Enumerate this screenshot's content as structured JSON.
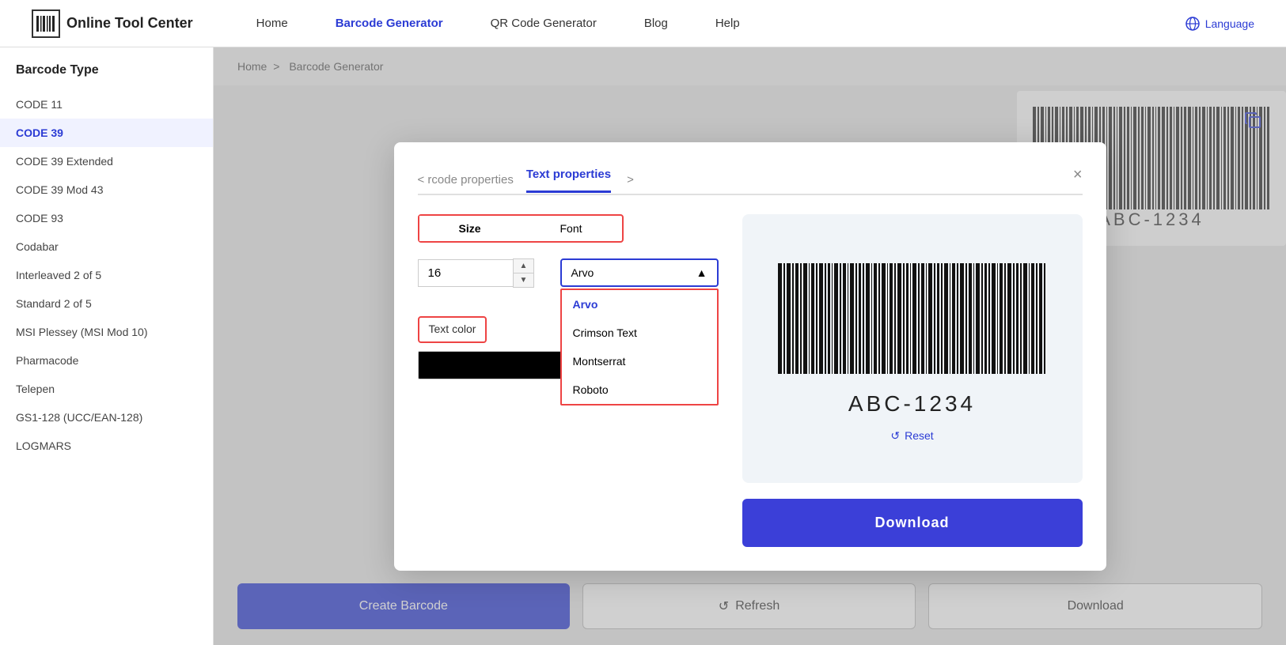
{
  "header": {
    "logo_text": "Online Tool Center",
    "nav_items": [
      {
        "label": "Home",
        "active": false
      },
      {
        "label": "Barcode Generator",
        "active": true
      },
      {
        "label": "QR Code Generator",
        "active": false
      },
      {
        "label": "Blog",
        "active": false
      },
      {
        "label": "Help",
        "active": false
      }
    ],
    "language_label": "Language"
  },
  "breadcrumb": {
    "home": "Home",
    "separator": ">",
    "current": "Barcode Generator"
  },
  "sidebar": {
    "title": "Barcode Type",
    "items": [
      {
        "label": "CODE 11",
        "active": false
      },
      {
        "label": "CODE 39",
        "active": true
      },
      {
        "label": "CODE 39 Extended",
        "active": false
      },
      {
        "label": "CODE 39 Mod 43",
        "active": false
      },
      {
        "label": "CODE 93",
        "active": false
      },
      {
        "label": "Codabar",
        "active": false
      },
      {
        "label": "Interleaved 2 of 5",
        "active": false
      },
      {
        "label": "Standard 2 of 5",
        "active": false
      },
      {
        "label": "MSI Plessey (MSI Mod 10)",
        "active": false
      },
      {
        "label": "Pharmacode",
        "active": false
      },
      {
        "label": "Telepen",
        "active": false
      },
      {
        "label": "GS1-128 (UCC/EAN-128)",
        "active": false
      },
      {
        "label": "LOGMARS",
        "active": false
      }
    ]
  },
  "modal": {
    "tab_prev": "< rcode properties",
    "tab_active": "Text properties",
    "tab_next": ">",
    "close_label": "×",
    "sub_tabs": [
      {
        "label": "Size",
        "active": true
      },
      {
        "label": "Font",
        "active": false
      }
    ],
    "size_value": "16",
    "font_selected": "Arvo",
    "font_options": [
      {
        "label": "Arvo",
        "selected": true
      },
      {
        "label": "Crimson Text",
        "selected": false
      },
      {
        "label": "Montserrat",
        "selected": false
      },
      {
        "label": "Roboto",
        "selected": false
      }
    ],
    "text_color_label": "Text color",
    "barcode_value": "ABC-1234",
    "reset_label": "Reset",
    "download_label": "Download"
  },
  "bottom_buttons": {
    "create_label": "Create Barcode",
    "refresh_label": "Refresh",
    "download_label": "Download"
  }
}
